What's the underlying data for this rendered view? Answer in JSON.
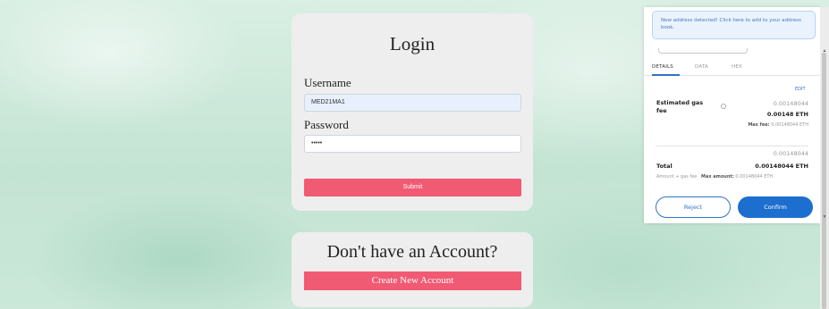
{
  "login": {
    "title": "Login",
    "username_label": "Username",
    "username_value": "MED21MA1",
    "password_label": "Password",
    "password_value": "•••••",
    "submit_label": "Submit"
  },
  "account": {
    "title": "Don't have an Account?",
    "create_label": "Create New Account"
  },
  "wallet": {
    "notice": "New address detected! Click here to add to your address book.",
    "tabs": [
      "DETAILS",
      "DATA",
      "HEX"
    ],
    "edit_label": "EDIT",
    "estimated_gas_label": "Estimated gas fee",
    "gas_fee_small": "0.00148044",
    "gas_fee_eth": "0.00148 ETH",
    "max_fee_label": "Max fee:",
    "max_fee_value": "0.00148044 ETH",
    "total_label": "Total",
    "total_small": "0.00148044",
    "total_eth": "0.00148044 ETH",
    "amount_gas_label": "Amount + gas fee",
    "max_amount_label": "Max amount:",
    "max_amount_value": "0.00148044 ETH",
    "reject_label": "Reject",
    "confirm_label": "Confirm"
  },
  "icons": [
    "info-icon",
    "scroll-up-icon",
    "scroll-down-icon"
  ],
  "colors": {
    "accent_pink": "#f05a72",
    "wallet_blue": "#1c6fce",
    "background": "#cfe9dc"
  }
}
